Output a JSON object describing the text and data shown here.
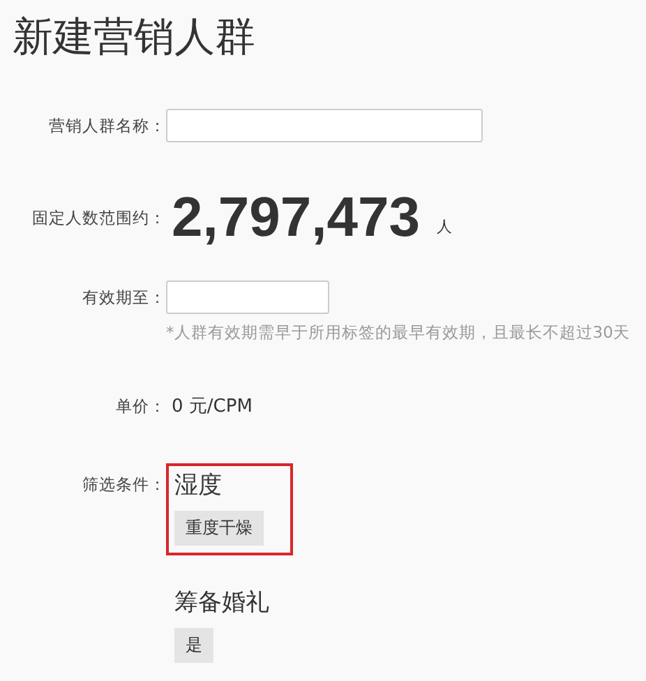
{
  "title": "新建营销人群",
  "fields": [
    {
      "kind": "input",
      "label": "营销人群名称：",
      "wide": true
    },
    {
      "kind": "count",
      "label": "固定人数范围约：",
      "value": "2,797,473",
      "unit": "人"
    },
    {
      "kind": "input",
      "label": "有效期至：",
      "wide": false,
      "hint": "*人群有效期需早于所用标签的最早有效期，且最长不超过30天"
    },
    {
      "kind": "text",
      "label": "单价：",
      "value": "0 元/CPM"
    }
  ],
  "filter_label": "筛选条件：",
  "filters": [
    {
      "title": "湿度",
      "tags": [
        "重度干燥"
      ],
      "highlighted": true
    },
    {
      "title": "筹备婚礼",
      "tags": [
        "是"
      ],
      "highlighted": false
    }
  ]
}
